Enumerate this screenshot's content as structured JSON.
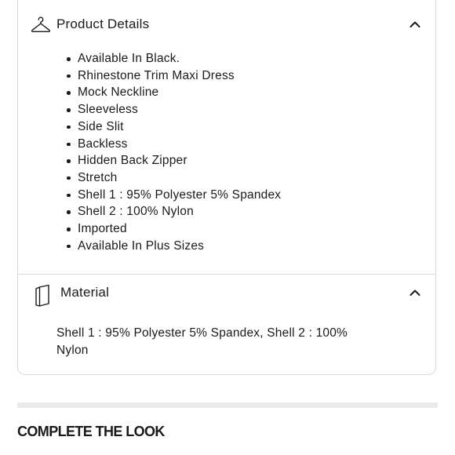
{
  "product_details": {
    "title": "Product Details",
    "icon": "hanger-icon",
    "expanded": true,
    "items": [
      "Available In Black.",
      "Rhinestone Trim Maxi Dress",
      "Mock Neckline",
      "Sleeveless",
      "Side Slit",
      "Backless",
      "Hidden Back Zipper",
      "Stretch",
      "Shell 1 : 95% Polyester 5% Spandex",
      "Shell 2 : 100% Nylon",
      "Imported",
      "Available In Plus Sizes"
    ]
  },
  "material": {
    "title": "Material",
    "icon": "fabric-swatch-icon",
    "expanded": true,
    "text": "Shell 1 : 95% Polyester 5% Spandex, Shell 2 : 100% Nylon"
  },
  "complete_the_look": {
    "title": "COMPLETE THE LOOK"
  },
  "colors": {
    "text": "#1a1a1a",
    "border": "#d9d9d9",
    "band": "#ebebeb"
  }
}
